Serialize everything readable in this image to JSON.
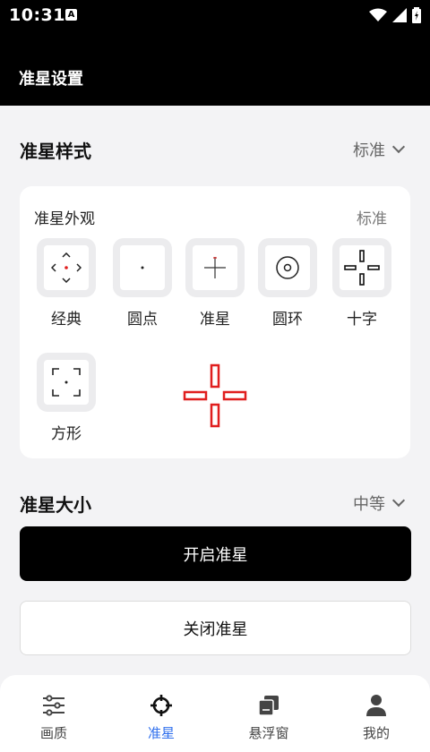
{
  "status": {
    "time": "10:31",
    "a_badge": "A"
  },
  "appbar": {
    "title": "准星设置"
  },
  "crosshair_style": {
    "title": "准星样式",
    "value": "标准"
  },
  "appearance": {
    "title": "准星外观",
    "badge": "标准",
    "styles": [
      {
        "label": "经典",
        "icon": "classic-crosshair-icon"
      },
      {
        "label": "圆点",
        "icon": "dot-crosshair-icon"
      },
      {
        "label": "准星",
        "icon": "sight-crosshair-icon"
      },
      {
        "label": "圆环",
        "icon": "ring-crosshair-icon"
      },
      {
        "label": "十字",
        "icon": "cross-crosshair-icon"
      },
      {
        "label": "方形",
        "icon": "square-crosshair-icon"
      }
    ],
    "preview_color": "#e01e1e"
  },
  "crosshair_size": {
    "title": "准星大小",
    "value": "中等"
  },
  "buttons": {
    "open": "开启准星",
    "close": "关闭准星"
  },
  "tabs": [
    {
      "label": "画质",
      "icon": "sliders-icon",
      "active": false
    },
    {
      "label": "准星",
      "icon": "crosshair-icon",
      "active": true
    },
    {
      "label": "悬浮窗",
      "icon": "floating-window-icon",
      "active": false
    },
    {
      "label": "我的",
      "icon": "profile-icon",
      "active": false
    }
  ],
  "colors": {
    "accent": "#2f6fed",
    "primary_button": "#000000"
  }
}
